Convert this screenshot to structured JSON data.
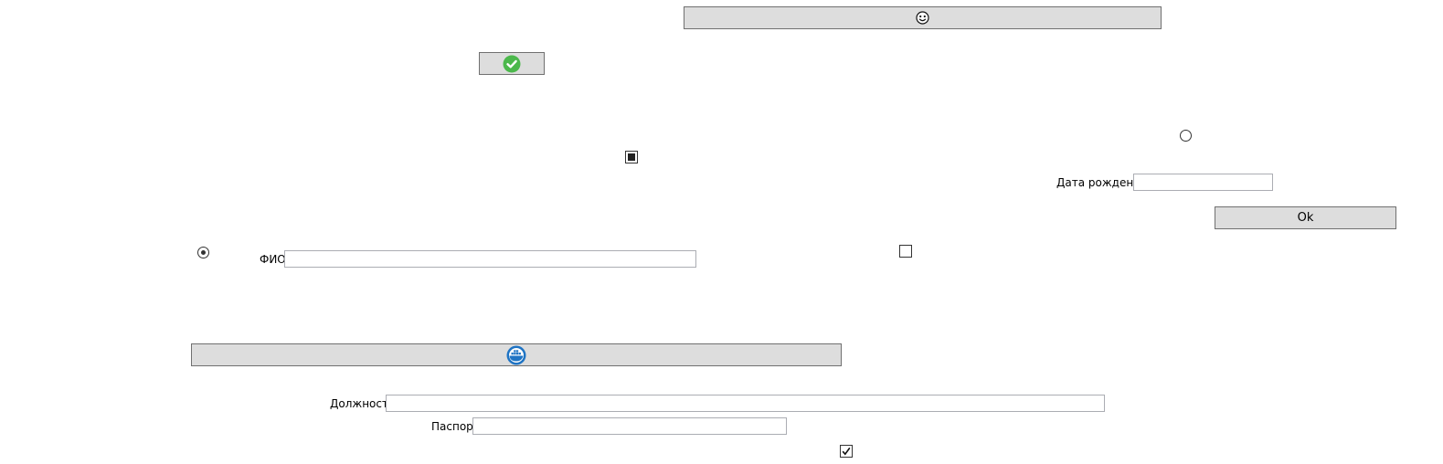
{
  "form": {
    "fio_label": "ФИО",
    "fio_value": "",
    "birthdate_label": "Дата рождения",
    "birthdate_value": "",
    "position_label": "Должность",
    "position_value": "",
    "passport_label": "Паспорт",
    "passport_value": ""
  },
  "buttons": {
    "ok_label": "Ok",
    "top_icon": "smiley-face-icon",
    "confirm_icon": "green-checkmark-icon",
    "bottom_icon": "blue-docker-whale-icon"
  },
  "controls": {
    "radio_left_checked": true,
    "radio_right_checked": false,
    "checkbox_indeterminate": true,
    "checkbox_empty_checked": false,
    "checkbox_bottom_checked": true
  },
  "colors": {
    "button_bg": "#dddddd",
    "button_border": "#707070",
    "field_border": "#abadb3",
    "check_green": "#4cb84c",
    "whale_blue": "#1f74c4"
  }
}
